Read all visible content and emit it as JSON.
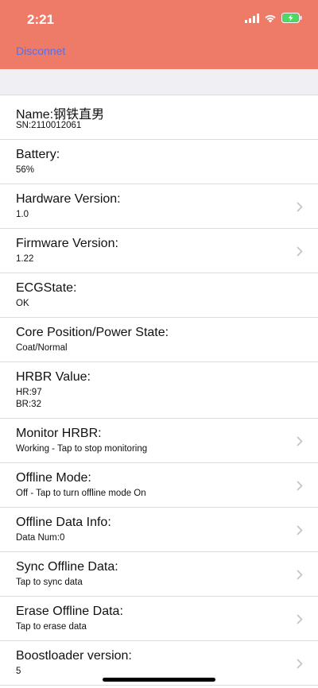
{
  "status": {
    "time": "2:21"
  },
  "nav": {
    "left_button": "Disconnet"
  },
  "rows": [
    {
      "title": "Name:钢铁直男",
      "lines": [
        "SN:2110012061"
      ],
      "chevron": false
    },
    {
      "title": "Battery:",
      "lines": [
        "56%"
      ],
      "chevron": false
    },
    {
      "title": "Hardware Version:",
      "lines": [
        "1.0"
      ],
      "chevron": true
    },
    {
      "title": "Firmware Version:",
      "lines": [
        "1.22"
      ],
      "chevron": true
    },
    {
      "title": "ECGState:",
      "lines": [
        "OK"
      ],
      "chevron": false
    },
    {
      "title": "Core Position/Power State:",
      "lines": [
        "Coat/Normal"
      ],
      "chevron": false
    },
    {
      "title": "HRBR Value:",
      "lines": [
        "HR:97",
        "BR:32"
      ],
      "chevron": false
    },
    {
      "title": "Monitor HRBR:",
      "lines": [
        "Working - Tap to stop monitoring"
      ],
      "chevron": true
    },
    {
      "title": "Offline Mode:",
      "lines": [
        "Off - Tap to turn offline mode On"
      ],
      "chevron": true
    },
    {
      "title": "Offline Data Info:",
      "lines": [
        "Data Num:0"
      ],
      "chevron": true
    },
    {
      "title": "Sync Offline Data:",
      "lines": [
        "Tap to sync data"
      ],
      "chevron": true
    },
    {
      "title": "Erase Offline Data:",
      "lines": [
        "Tap to erase data"
      ],
      "chevron": true
    },
    {
      "title": "Boostloader version:",
      "lines": [
        "5"
      ],
      "chevron": true
    }
  ],
  "colors": {
    "header": "#ee7a68",
    "link": "#5a6ee8",
    "battery": "#4cd964"
  },
  "icons": [
    "signal-icon",
    "wifi-icon",
    "battery-charging-icon",
    "chevron-right-icon"
  ]
}
